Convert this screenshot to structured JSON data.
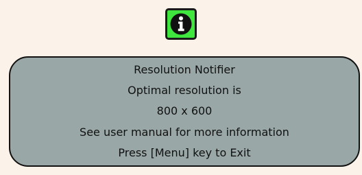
{
  "icon": {
    "name": "info-icon",
    "background": "#3ee63e",
    "border": "#1a1a1a"
  },
  "panel": {
    "background": "#99a7a6",
    "border": "#111111"
  },
  "notifier": {
    "title": "Resolution Notifier",
    "line1": "Optimal resolution is",
    "resolution": "800 x 600",
    "line3": "See user manual for more information",
    "exit_hint": "Press [Menu] key to Exit"
  }
}
